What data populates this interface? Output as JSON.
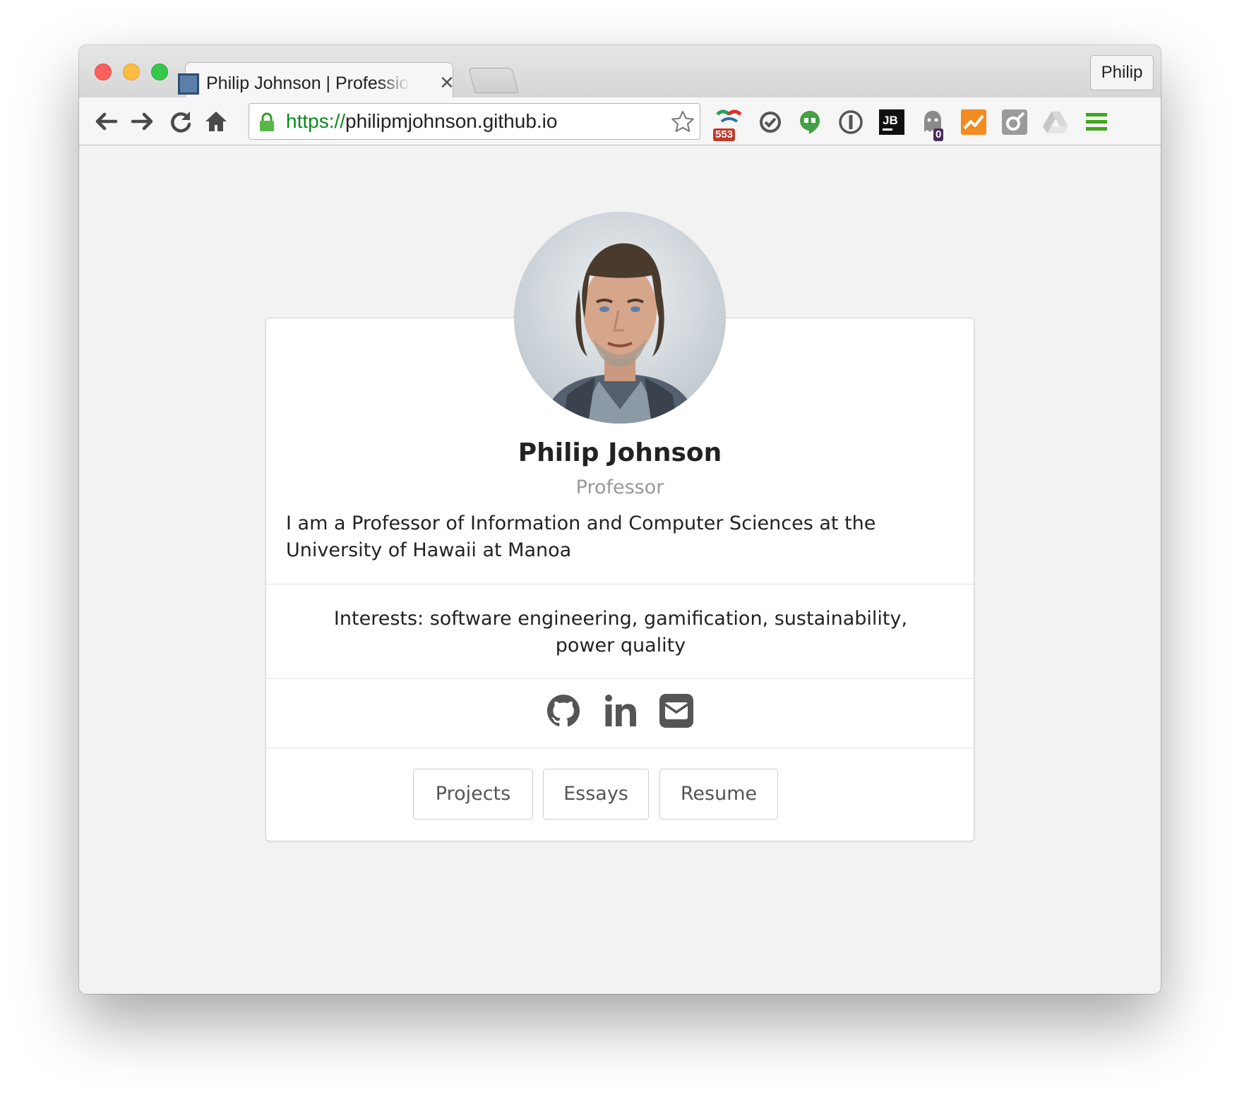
{
  "browser": {
    "tab": {
      "title": "Philip Johnson | Professional Portfolio",
      "close_glyph": "✕"
    },
    "profile_label": "Philip",
    "address_bar": {
      "scheme": "https://",
      "host": "philipmjohnson.github.io"
    },
    "nav_icons": [
      "back-arrow-icon",
      "forward-arrow-icon",
      "reload-icon",
      "home-icon"
    ],
    "extensions": [
      {
        "name": "feed-extension-icon",
        "badge": "553",
        "badge_color": "#c0392b"
      },
      {
        "name": "sync-extension-icon"
      },
      {
        "name": "hangouts-extension-icon",
        "color": "#43a047"
      },
      {
        "name": "1password-extension-icon"
      },
      {
        "name": "jetbrains-extension-icon",
        "label": "JB"
      },
      {
        "name": "ghostery-extension-icon",
        "badge": "0",
        "badge_color": "#4b2a5c"
      },
      {
        "name": "analytics-extension-icon",
        "color": "#f28b20"
      },
      {
        "name": "postman-extension-icon"
      },
      {
        "name": "drive-extension-icon"
      },
      {
        "name": "chrome-menu-icon",
        "color": "#3ea81a"
      }
    ]
  },
  "profile": {
    "name": "Philip Johnson",
    "title": "Professor",
    "bio": "I am a Professor of Information and Computer Sciences at the University of Hawaii at Manoa",
    "interests": "Interests: software engineering, gamification, sustainability, power quality",
    "social": [
      "github-icon",
      "linkedin-icon",
      "email-icon"
    ],
    "buttons": [
      "Projects",
      "Essays",
      "Resume"
    ]
  },
  "colors": {
    "page_background": "#f2f2f2",
    "card_background": "#ffffff",
    "muted_text": "#999999",
    "url_scheme": "#0b8a1e"
  }
}
